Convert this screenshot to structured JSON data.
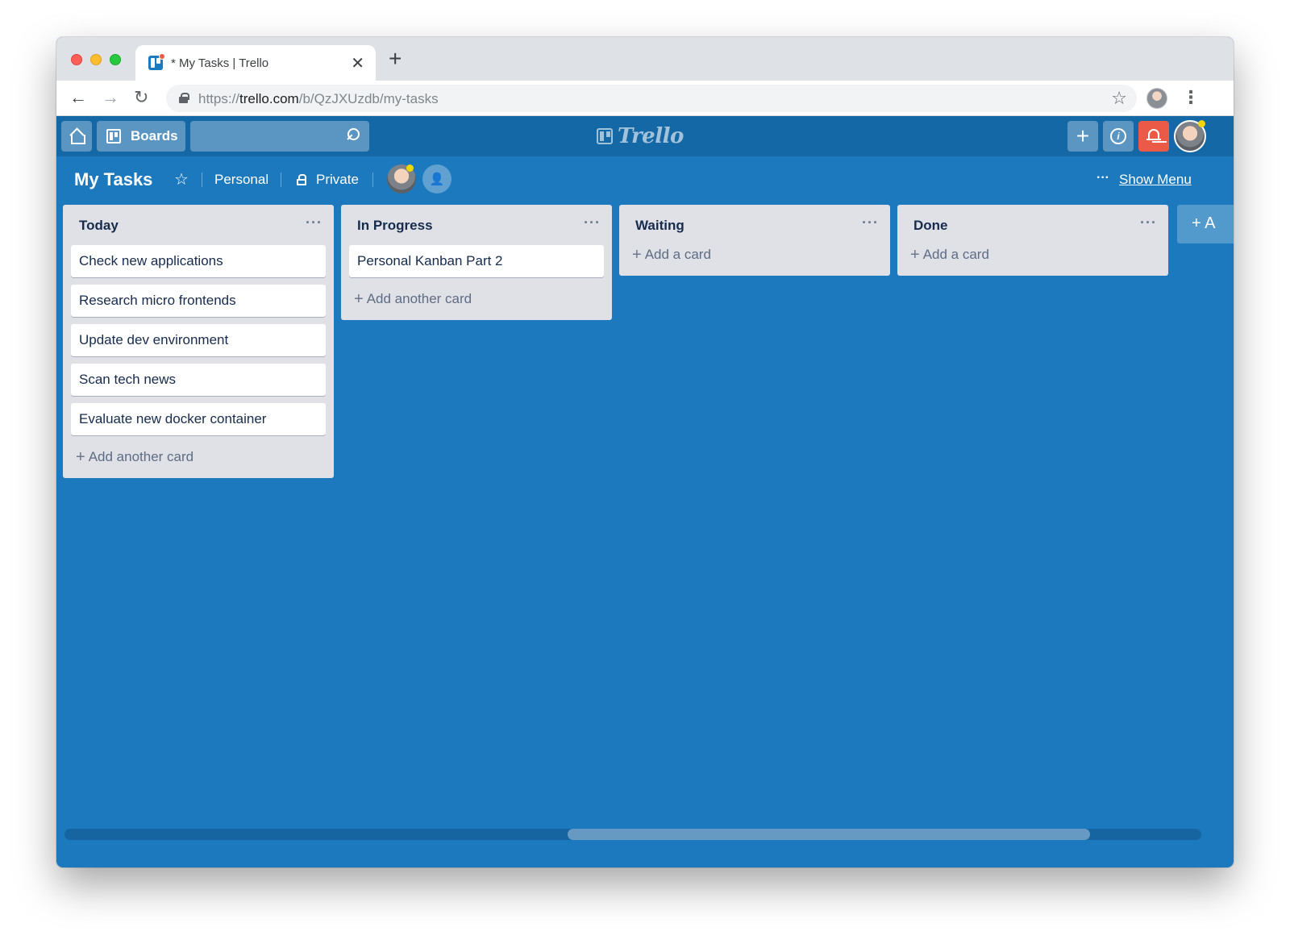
{
  "browser": {
    "tab_title": "* My Tasks | Trello",
    "close_glyph": "✕",
    "new_tab_glyph": "+",
    "url_scheme": "https://",
    "url_host": "trello.com",
    "url_path": "/b/QzJXUzdb/my-tasks",
    "back_glyph": "←",
    "forward_glyph": "→",
    "reload_glyph": "↻",
    "star_glyph": "☆",
    "menu_glyph": "⋮"
  },
  "header": {
    "boards_label": "Boards",
    "logo_text": "Trello",
    "plus_glyph": "+",
    "info_glyph": "i",
    "notification_color": "#eb5a46"
  },
  "board": {
    "title": "My Tasks",
    "star_glyph": "☆",
    "team": "Personal",
    "visibility": "Private",
    "invite_glyph": "👤",
    "menu_dots": "···",
    "show_menu": "Show Menu",
    "background_color": "#1c79bd"
  },
  "lists": [
    {
      "title": "Today",
      "menu": "···",
      "cards": [
        "Check new applications",
        "Research micro frontends",
        "Update dev environment",
        "Scan tech news",
        "Evaluate new docker container"
      ],
      "add_label": "Add another card"
    },
    {
      "title": "In Progress",
      "menu": "···",
      "cards": [
        "Personal Kanban Part 2"
      ],
      "add_label": "Add another card"
    },
    {
      "title": "Waiting",
      "menu": "···",
      "cards": [],
      "add_label": "Add a card"
    },
    {
      "title": "Done",
      "menu": "···",
      "cards": [],
      "add_label": "Add a card"
    }
  ],
  "add_list_glyph": "+ A",
  "add_card_glyph": "+"
}
